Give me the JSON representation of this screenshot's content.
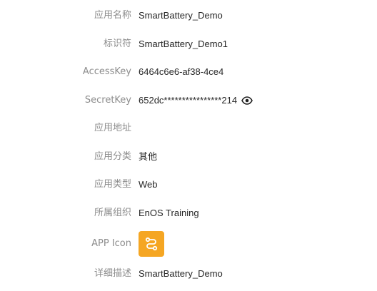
{
  "fields": {
    "app_name": {
      "label": "应用名称",
      "value": "SmartBattery_Demo"
    },
    "identifier": {
      "label": "标识符",
      "value": "SmartBattery_Demo1"
    },
    "access_key": {
      "label": "AccessKey",
      "value": "6464c6e6-af38-4ce4"
    },
    "secret_key": {
      "label": "SecretKey",
      "value": "652dc****************214",
      "toggle_icon": "eye-icon"
    },
    "app_address": {
      "label": "应用地址",
      "value": ""
    },
    "app_category": {
      "label": "应用分类",
      "value": "其他"
    },
    "app_type": {
      "label": "应用类型",
      "value": "Web"
    },
    "organization": {
      "label": "所属组织",
      "value": "EnOS Training"
    },
    "app_icon": {
      "label": "APP Icon",
      "icon": "link-nodes-icon",
      "color": "#f5a623"
    },
    "description": {
      "label": "详细描述",
      "value": "SmartBattery_Demo"
    }
  }
}
